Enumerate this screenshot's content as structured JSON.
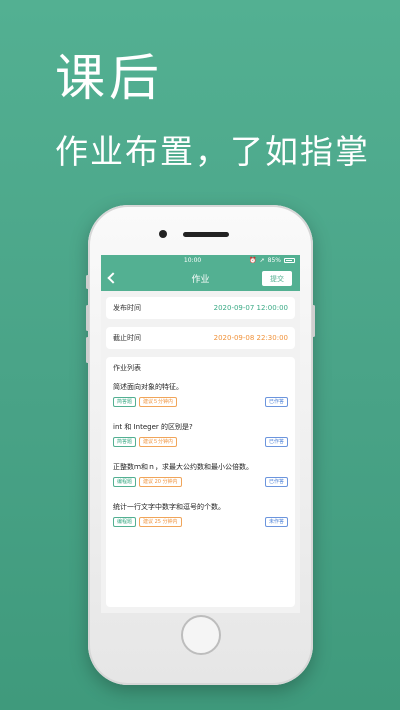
{
  "promo": {
    "headline": "课后",
    "subline": "作业布置，了如指掌"
  },
  "status_bar": {
    "time": "10:00",
    "battery": "85%",
    "icons": [
      "alarm-icon",
      "location-icon",
      "battery-icon"
    ]
  },
  "nav": {
    "back_icon": "chevron-left-icon",
    "title": "作业",
    "submit_label": "提交"
  },
  "publish": {
    "label": "发布时间",
    "value": "2020-09-07 12:00:00"
  },
  "deadline": {
    "label": "截止时间",
    "value": "2020-09-08 22:30:00"
  },
  "list": {
    "title": "作业列表",
    "items": [
      {
        "question": "简述面向对象的特征。",
        "type": "简答题",
        "time": "建议５分钟内",
        "status": "已作答"
      },
      {
        "question": "int 和 Integer 的区别是?",
        "type": "简答题",
        "time": "建议５分钟内",
        "status": "已作答"
      },
      {
        "question": "正整数ｍ和ｎ，求最大公约数和最小公倍数。",
        "type": "编程题",
        "time": "建议 20 分钟内",
        "status": "已作答"
      },
      {
        "question": "统计一行文字中数字和逗号的个数。",
        "type": "编程题",
        "time": "建议 25 分钟内",
        "status": "未作答"
      }
    ]
  },
  "colors": {
    "brand_green": "#53b092",
    "time_green": "#3aaa85",
    "deadline_orange": "#f0923a",
    "status_blue": "#4a7fd6"
  }
}
